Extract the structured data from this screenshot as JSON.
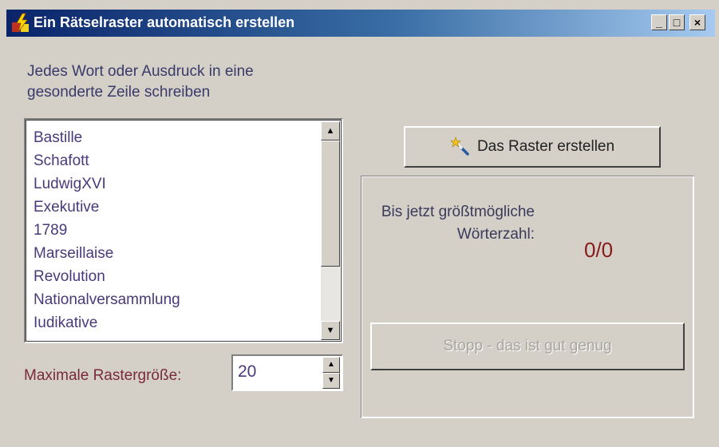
{
  "window": {
    "title": "Ein Rätselraster automatisch erstellen",
    "controls": {
      "minimize": "_",
      "maximize": "□",
      "close": "×"
    }
  },
  "instructions": "Jedes Wort oder Ausdruck in eine gesonderte Zeile schreiben",
  "word_list": {
    "items": [
      "Bastille",
      "Schafott",
      "LudwigXVI",
      "Exekutive",
      "1789",
      "Marseillaise",
      "Revolution",
      "Nationalversammlung",
      "Iudikative"
    ]
  },
  "grid_size": {
    "label": "Maximale Rastergröße:",
    "value": "20"
  },
  "create_button": {
    "label": "Das Raster erstellen",
    "icon": "magic-wand-icon"
  },
  "status": {
    "label": "Bis jetzt größtmögliche Wörterzahl:",
    "value": "0/0"
  },
  "stop_button": {
    "label": "Stopp - das ist gut genug",
    "enabled": false
  },
  "colors": {
    "title_gradient_start": "#0a246a",
    "title_gradient_end": "#a6caf0",
    "window_bg": "#d4d0c8",
    "status_value": "#8a1a1a"
  }
}
